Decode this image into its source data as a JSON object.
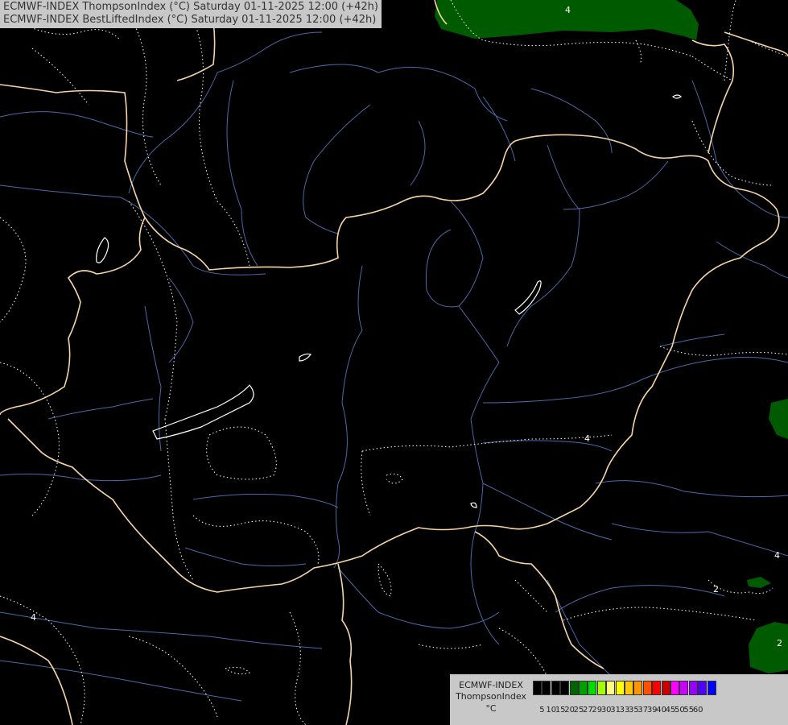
{
  "header": {
    "line1": "ECMWF-INDEX ThompsonIndex (°C) Saturday 01-11-2025 12:00 (+42h)",
    "line2": "ECMWF-INDEX BestLiftedIndex (°C) Saturday 01-11-2025 12:00 (+42h)"
  },
  "legend": {
    "title1": "ECMWF-INDEX",
    "title2": "ThompsonIndex",
    "unit": "°C",
    "colors": [
      "#000000",
      "#000000",
      "#000000",
      "#000000",
      "#006400",
      "#00a000",
      "#00dc00",
      "#a0ff00",
      "#ffff80",
      "#ffff00",
      "#ffc800",
      "#ff9600",
      "#ff5000",
      "#ff0000",
      "#c80000",
      "#ff00ff",
      "#c800ff",
      "#9600ff",
      "#5000ff",
      "#0000ff"
    ],
    "ticks": [
      "5",
      "10",
      "15",
      "20",
      "25",
      "27",
      "29",
      "30",
      "31",
      "33",
      "35",
      "37",
      "39",
      "40",
      "45",
      "50",
      "55",
      "60"
    ]
  },
  "map": {
    "contour_labels": [
      "4",
      "4",
      "2",
      "2",
      "4",
      "4"
    ],
    "colors": {
      "background": "#000000",
      "border": "#f5d5a8",
      "river": "#4a6aa8",
      "contour": "#ffffff",
      "green_fill": "#005a00"
    }
  }
}
